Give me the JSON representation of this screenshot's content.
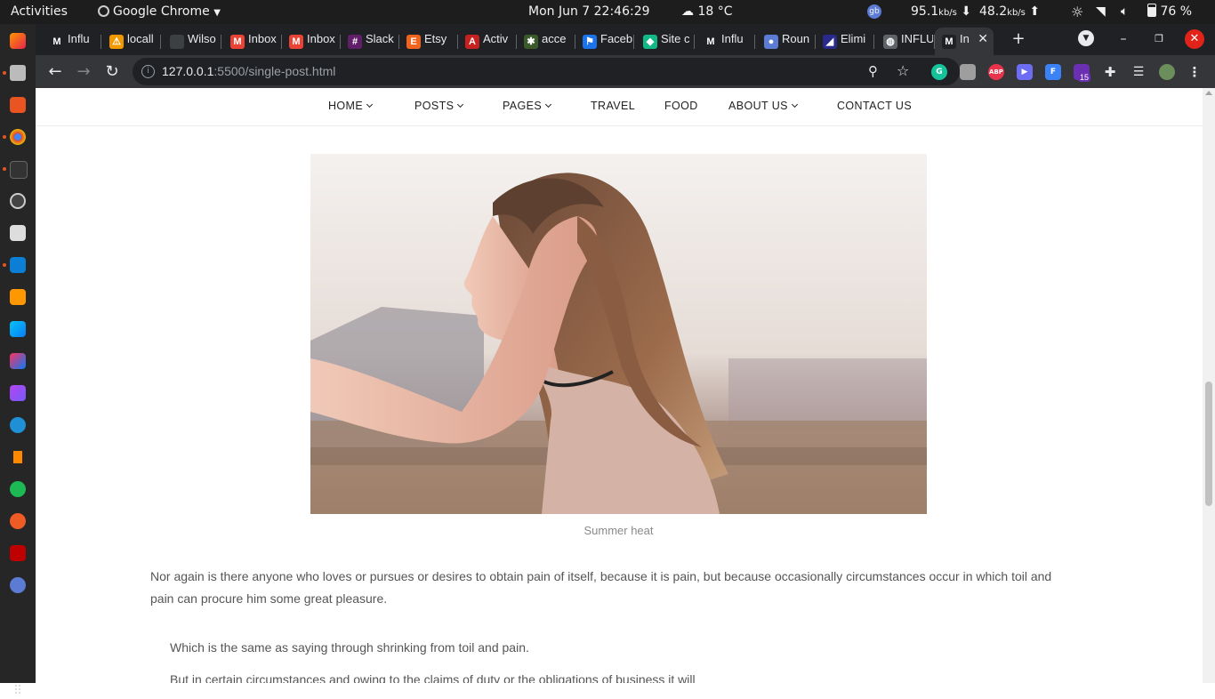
{
  "system": {
    "activities": "Activities",
    "app_menu": "Google Chrome",
    "datetime": "Mon Jun 7  22:46:29",
    "weather": "18 °C",
    "net_down": "95.1",
    "net_down_unit": "kb/s",
    "net_up": "48.2",
    "net_up_unit": "kb/s",
    "battery": "76 %",
    "avatar_initials": "gb"
  },
  "dock": {
    "items": [
      "firefox",
      "files",
      "software",
      "chrome",
      "terminal",
      "obs",
      "settings",
      "vscode",
      "sublime",
      "webstorm",
      "intellij",
      "phpstorm",
      "kodi",
      "vlc",
      "spotify",
      "postman",
      "filezilla",
      "gb"
    ]
  },
  "tabs": [
    {
      "title": "Influ",
      "icon": "M",
      "color": "#202124"
    },
    {
      "title": "locall",
      "icon": "⚠",
      "color": "#f29900"
    },
    {
      "title": "Wilso",
      "icon": "",
      "color": "#3c4043"
    },
    {
      "title": "Inbox",
      "icon": "M",
      "color": "#ea4335"
    },
    {
      "title": "Inbox",
      "icon": "M",
      "color": "#ea4335"
    },
    {
      "title": "Slack",
      "icon": "#",
      "color": "#611f69"
    },
    {
      "title": "Etsy",
      "icon": "E",
      "color": "#f1641e"
    },
    {
      "title": "Activ",
      "icon": "A",
      "color": "#c5221f"
    },
    {
      "title": "acce",
      "icon": "✱",
      "color": "#3a5a2a"
    },
    {
      "title": "Faceb",
      "icon": "⚑",
      "color": "#1a73e8"
    },
    {
      "title": "Site c",
      "icon": "◆",
      "color": "#12b886"
    },
    {
      "title": "Influ",
      "icon": "M",
      "color": "#202124"
    },
    {
      "title": "Roun",
      "icon": "●",
      "color": "#5b7bd5"
    },
    {
      "title": "Elimi",
      "icon": "◢",
      "color": "#2a2a8a"
    },
    {
      "title": "INFLU",
      "icon": "◍",
      "color": "#5f6368"
    },
    {
      "title": "In",
      "icon": "M",
      "color": "#202124"
    }
  ],
  "browser": {
    "url_host": "127.0.0.1",
    "url_path": ":5500/single-post.html",
    "extension_badge": "15"
  },
  "page": {
    "nav": [
      {
        "label": "HOME",
        "dropdown": true
      },
      {
        "label": "POSTS",
        "dropdown": true
      },
      {
        "label": "PAGES",
        "dropdown": true
      },
      {
        "label": "TRAVEL",
        "dropdown": false
      },
      {
        "label": "FOOD",
        "dropdown": false
      },
      {
        "label": "ABOUT US",
        "dropdown": true
      },
      {
        "label": "CONTACT US",
        "dropdown": false
      }
    ],
    "image_caption": "Summer heat",
    "paragraph": "Nor again is there anyone who loves or pursues or desires to obtain pain of itself, because it is pain, but because occasionally circumstances occur in which toil and pain can procure him some great pleasure.",
    "list_items": [
      "Which is the same as saying through shrinking from toil and pain.",
      "But in certain circumstances and owing to the claims of duty or the obligations of business it will"
    ]
  }
}
